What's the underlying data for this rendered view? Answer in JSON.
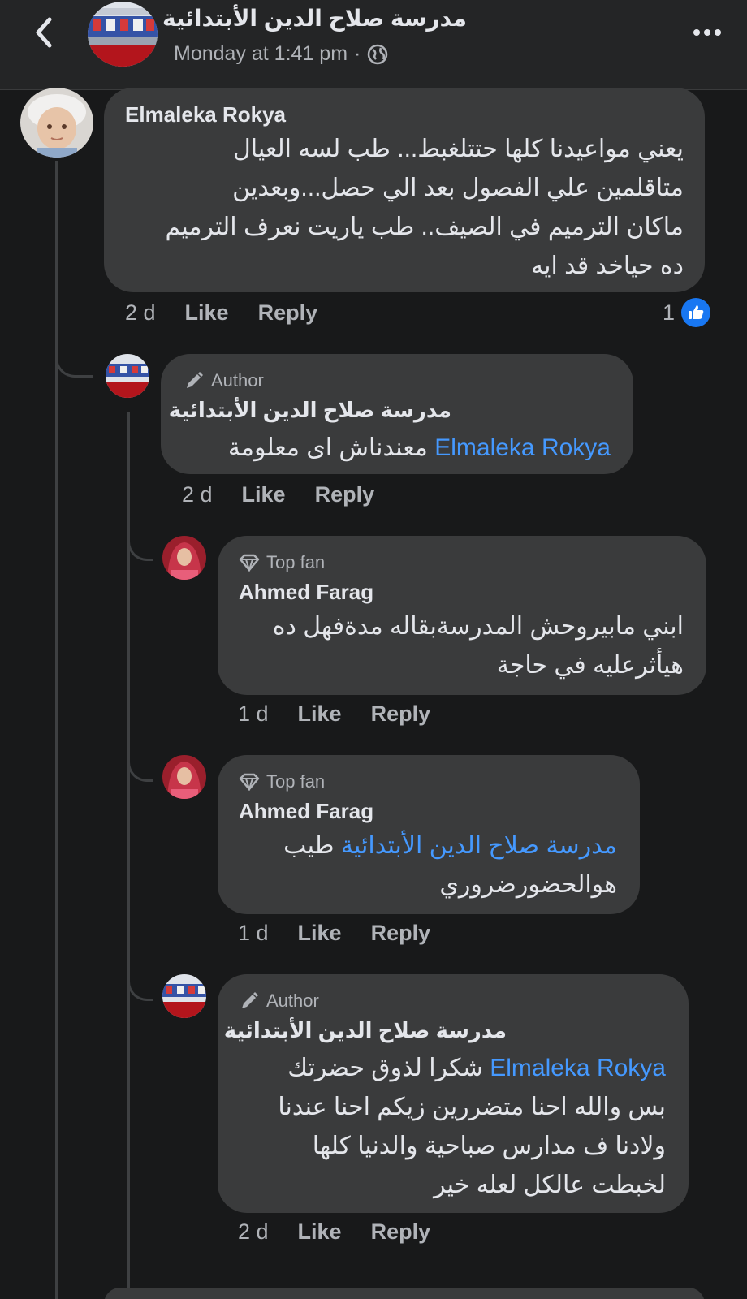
{
  "header": {
    "page_name": "مدرسة صلاح الدين الأبتدائية",
    "post_time": "Monday at 1:41 pm",
    "separator": "·",
    "back_icon": "chevron-left-icon",
    "privacy_icon": "globe-icon",
    "more_icon": "more-dots-icon"
  },
  "comments": [
    {
      "author": "Elmaleka Rokya",
      "lines": [
        "يعني مواعيدنا كلها حتتلغبط... طب لسه العيال",
        "متاقلمين علي الفصول بعد الي حصل...وبعدين",
        "ماكان الترميم في الصيف.. طب ياريت نعرف الترميم",
        "ده حياخد قد ايه"
      ],
      "time": "2 d",
      "like_label": "Like",
      "reply_label": "Reply",
      "reaction_count": "1"
    },
    {
      "badge": "Author",
      "author": "مدرسة صلاح الدين الأبتدائية",
      "mention": "Elmaleka Rokya",
      "text_after_mention": "معندناش اى معلومة",
      "time": "2 d",
      "like_label": "Like",
      "reply_label": "Reply"
    },
    {
      "badge": "Top fan",
      "author": "Ahmed Farag",
      "lines": [
        "ابني مابيروحش المدرسةبقاله مدةفهل ده",
        "هيأثرعليه في حاجة"
      ],
      "time": "1 d",
      "like_label": "Like",
      "reply_label": "Reply"
    },
    {
      "badge": "Top fan",
      "author": "Ahmed Farag",
      "mention": "مدرسة صلاح الدين الأبتدائية",
      "text_after_mention": "طيب",
      "line2": "هوالحضورضروري",
      "time": "1 d",
      "like_label": "Like",
      "reply_label": "Reply"
    },
    {
      "badge": "Author",
      "author": "مدرسة صلاح الدين الأبتدائية",
      "mention": "Elmaleka Rokya",
      "text_after_mention": "شكرا لذوق حضرتك",
      "lines": [
        "بس والله احنا متضررين زيكم احنا عندنا",
        "ولادنا ف مدارس صباحية والدنيا كلها",
        "لخبطت عالكل لعله خير"
      ],
      "time": "2 d",
      "like_label": "Like",
      "reply_label": "Reply"
    }
  ],
  "colors": {
    "background": "#18191a",
    "bubble": "#3a3b3c",
    "mention": "#4599ff",
    "like_blue": "#1877f2"
  }
}
